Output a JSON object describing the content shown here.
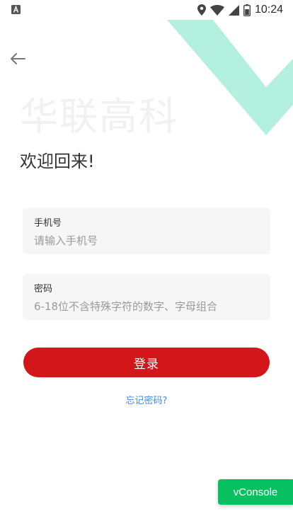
{
  "status_bar": {
    "time": "10:24",
    "icons": [
      "app-notification-icon",
      "location-icon",
      "wifi-icon",
      "signal-icon",
      "battery-icon"
    ]
  },
  "nav": {
    "back_icon": "arrow-left-icon"
  },
  "brand": {
    "watermark": "华联高科",
    "decor_color": "#b4f0df"
  },
  "welcome": {
    "title": "欢迎回来!"
  },
  "form": {
    "phone": {
      "label": "手机号",
      "value": "",
      "placeholder": "请输入手机号"
    },
    "password": {
      "label": "密码",
      "value": "",
      "placeholder": "6-18位不含特殊字符的数字、字母组合"
    },
    "login_label": "登录",
    "forgot_label": "忘记密码?"
  },
  "colors": {
    "accent": "#d2161a",
    "link": "#3f8ddb",
    "vconsole": "#07c160"
  },
  "vconsole": {
    "label": "vConsole"
  }
}
